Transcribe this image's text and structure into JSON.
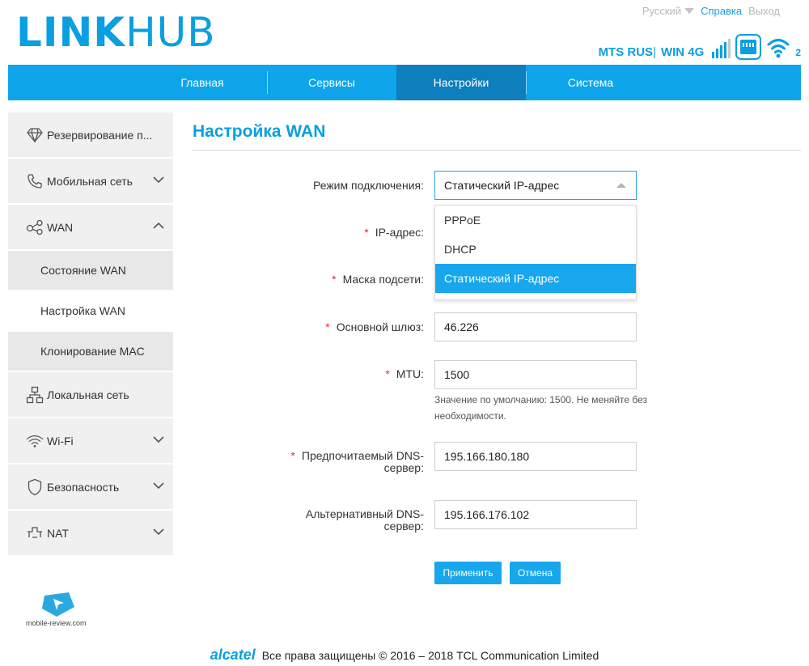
{
  "logo": {
    "part1": "LINK",
    "part2": "HUB"
  },
  "toplinks": {
    "language": "Русский",
    "help": "Справка",
    "logout": "Выход"
  },
  "status": {
    "operator": "MTS RUS",
    "separator": "|",
    "network": "WIN 4G",
    "wifi_clients": "2"
  },
  "nav": {
    "tabs": [
      "Главная",
      "Сервисы",
      "Настройки",
      "Система"
    ],
    "active_index": 2
  },
  "sidebar": {
    "items": [
      {
        "label": "Резервирование п..."
      },
      {
        "label": "Мобильная сеть"
      },
      {
        "label": "WAN"
      },
      {
        "label": "Локальная сеть"
      },
      {
        "label": "Wi-Fi"
      },
      {
        "label": "Безопасность"
      },
      {
        "label": "NAT"
      }
    ],
    "wan_sub": [
      "Состояние WAN",
      "Настройка WAN",
      "Клонирование MAC"
    ]
  },
  "page": {
    "title": "Настройка WAN"
  },
  "form": {
    "mode_label": "Режим подключения:",
    "mode_value": "Статический IP-адрес",
    "mode_options": [
      "PPPoE",
      "DHCP",
      "Статический IP-адрес"
    ],
    "ip_label": "IP-адрес:",
    "mask_label": "Маска подсети:",
    "gateway_label": "Основной шлюз:",
    "gateway_value": "46.226",
    "mtu_label": "MTU:",
    "mtu_value": "1500",
    "mtu_hint": "Значение по умолчанию: 1500. Не меняйте без необходимости.",
    "dns1_label_1": "Предпочитаемый DNS-",
    "dns1_label_2": "сервер:",
    "dns1_value": "195.166.180.180",
    "dns2_label_1": "Альтернативный DNS-",
    "dns2_label_2": "сервер:",
    "dns2_value": "195.166.176.102",
    "required_mark": "*"
  },
  "buttons": {
    "apply": "Применить",
    "cancel": "Отмена"
  },
  "footer": {
    "brand": "alcatel",
    "copyright": "Все права защищены © 2016 – 2018 TCL Communication Limited"
  },
  "watermark": {
    "text": "mobile-review.com"
  },
  "colors": {
    "accent": "#0a9fe0",
    "nav_bg": "#0fa5eb",
    "nav_active": "#0d7fbc",
    "required": "#e0302e"
  }
}
